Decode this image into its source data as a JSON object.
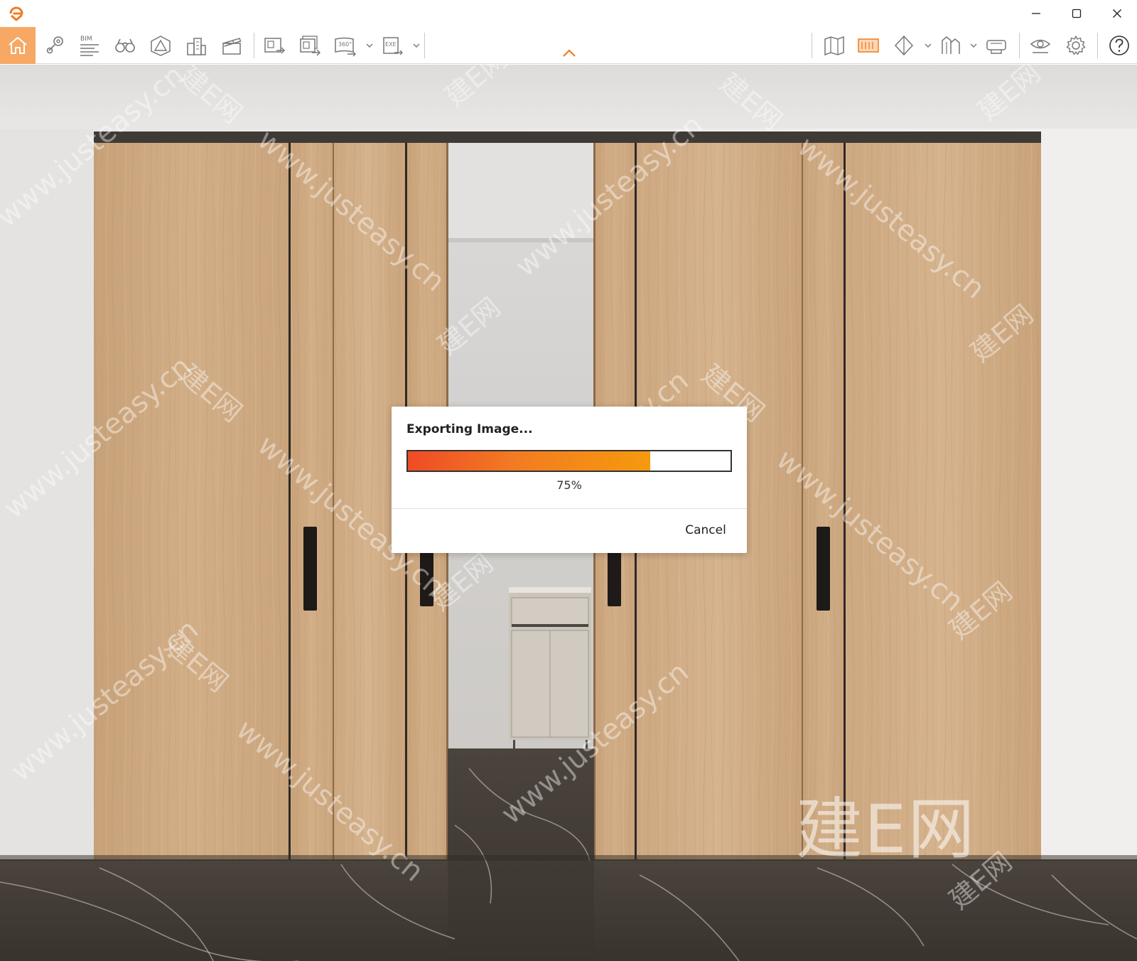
{
  "titlebar": {
    "controls": [
      {
        "name": "minimize",
        "icon": "minimize-icon"
      },
      {
        "name": "maximize",
        "icon": "maximize-icon"
      },
      {
        "name": "close",
        "icon": "close-icon"
      }
    ]
  },
  "toolbar": {
    "accent_color": "#f6a864",
    "bim_label": "BIM",
    "icons": [
      "home-icon",
      "location-pin-icon",
      "bim-list-icon",
      "binoculars-icon",
      "object-library-icon",
      "buildings-icon",
      "clapperboard-icon",
      "export-image-icon",
      "batch-export-icon",
      "export-360-icon",
      "export-exe-icon",
      "map-icon",
      "texture-panel-icon",
      "section-icon",
      "multi-view-icon",
      "vr-headset-icon",
      "visibility-icon",
      "settings-gear-icon",
      "help-icon"
    ],
    "badge_360": "360°",
    "badge_exe": "EXE"
  },
  "watermark": {
    "site": "www.justeasy.cn",
    "brand": "建E网"
  },
  "dialog": {
    "title": "Exporting Image...",
    "progress_percent": 75,
    "progress_label": "75%",
    "cancel_label": "Cancel",
    "progress_colors": [
      "#ef4b26",
      "#f59a0d"
    ]
  }
}
